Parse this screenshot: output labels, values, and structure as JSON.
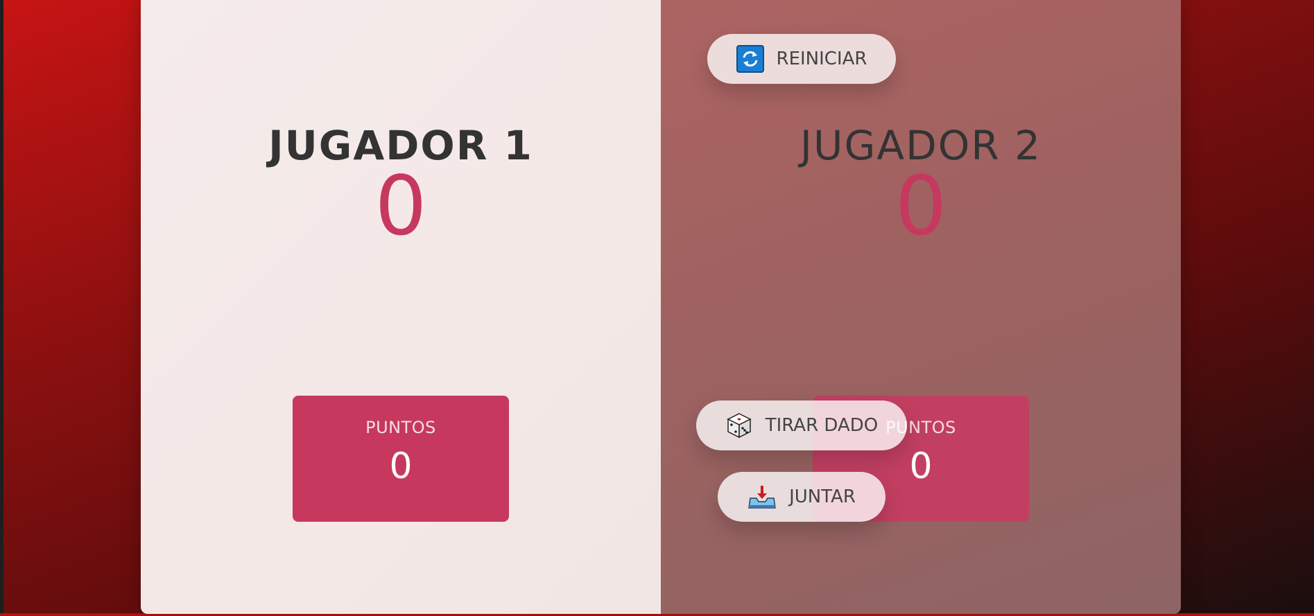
{
  "players": [
    {
      "name": "JUGADOR 1",
      "score": "0",
      "current_label": "PUNTOS",
      "current_score": "0",
      "active": true
    },
    {
      "name": "JUGADOR 2",
      "score": "0",
      "current_label": "PUNTOS",
      "current_score": "0",
      "active": false
    }
  ],
  "buttons": {
    "new_game": {
      "label": "REINICIAR",
      "icon": "refresh-icon"
    },
    "roll": {
      "label": "TIRAR DADO",
      "icon": "dice-icon"
    },
    "hold": {
      "label": "JUNTAR",
      "icon": "inbox-tray-icon"
    }
  },
  "colors": {
    "accent": "#c7385e",
    "active_panel": "#f5ebea",
    "inactive_panel": "#a0615f",
    "background": "#8a1010"
  }
}
